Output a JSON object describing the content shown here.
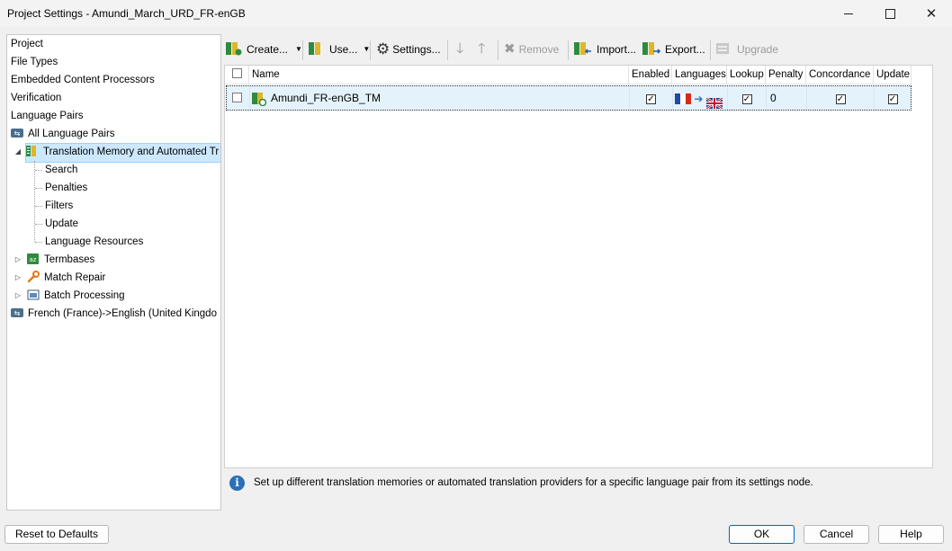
{
  "window": {
    "title": "Project Settings - Amundi_March_URD_FR-enGB"
  },
  "sidebar": {
    "items": [
      {
        "label": "Project"
      },
      {
        "label": "File Types"
      },
      {
        "label": "Embedded Content Processors"
      },
      {
        "label": "Verification"
      },
      {
        "label": "Language Pairs"
      },
      {
        "label": "All Language Pairs"
      },
      {
        "label": "Translation Memory and Automated Tr"
      },
      {
        "label": "Search"
      },
      {
        "label": "Penalties"
      },
      {
        "label": "Filters"
      },
      {
        "label": "Update"
      },
      {
        "label": "Language Resources"
      },
      {
        "label": "Termbases"
      },
      {
        "label": "Match Repair"
      },
      {
        "label": "Batch Processing"
      },
      {
        "label": "French (France)->English (United Kingdo"
      }
    ]
  },
  "toolbar": {
    "create": "Create...",
    "use": "Use...",
    "settings": "Settings...",
    "remove": "Remove",
    "import": "Import...",
    "export": "Export...",
    "upgrade": "Upgrade"
  },
  "grid": {
    "headers": {
      "name": "Name",
      "enabled": "Enabled",
      "languages": "Languages",
      "lookup": "Lookup",
      "penalty": "Penalty",
      "concordance": "Concordance",
      "update": "Update"
    },
    "rows": [
      {
        "name": "Amundi_FR-enGB_TM",
        "enabled": true,
        "lookup": true,
        "penalty": "0",
        "concordance": true,
        "update": true
      }
    ]
  },
  "info": {
    "text": "Set up different translation memories or automated translation providers for a specific language pair from its settings node."
  },
  "buttons": {
    "reset": "Reset to Defaults",
    "ok": "OK",
    "cancel": "Cancel",
    "help": "Help"
  },
  "colors": {
    "accent": "#0067c0",
    "selection": "#cce8ff",
    "row_selection": "#e4f2fb"
  }
}
